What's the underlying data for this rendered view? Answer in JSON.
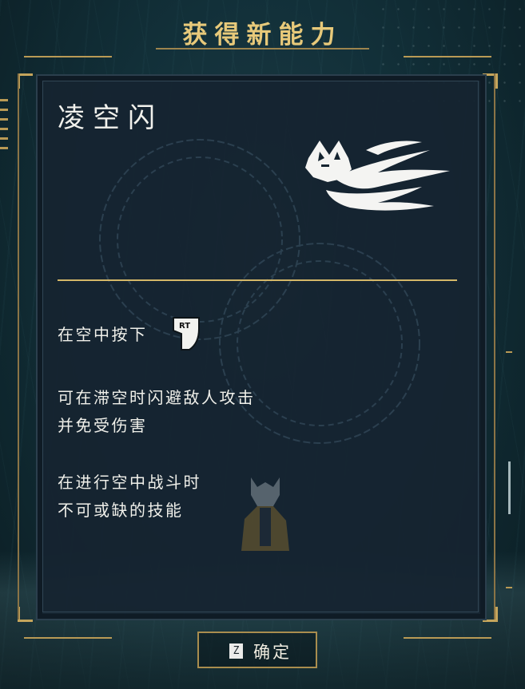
{
  "header": {
    "title": "获得新能力"
  },
  "skill": {
    "name": "凌空闪",
    "icon": "spirit-fox-dash-icon",
    "instruction": "在空中按下",
    "button_glyph": "RT",
    "description_lines": [
      "可在滞空时闪避敌人攻击",
      "并免受伤害"
    ],
    "note_lines": [
      "在进行空中战斗时",
      "不可或缺的技能"
    ]
  },
  "confirm": {
    "key": "Z",
    "label": "确定"
  },
  "colors": {
    "accent_gold": "#d4b768",
    "panel_bg": "#152430",
    "text": "#f0f0ea"
  }
}
